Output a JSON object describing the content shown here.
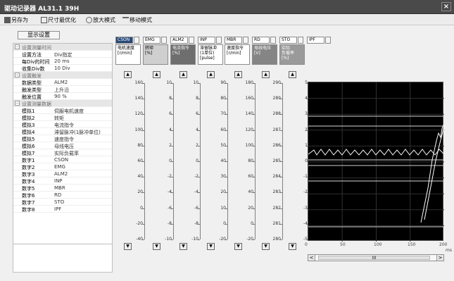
{
  "app_title": "驱动记录器  AL31.1  39H",
  "toolbar": {
    "save_as": "另存为",
    "fit": "尺寸最优化",
    "zoom": "放大模式",
    "move": "移动模式"
  },
  "show_settings": "显示设置",
  "tree": {
    "rows": [
      {
        "type": "group",
        "label": "设置测量时间"
      },
      {
        "type": "item",
        "label": "设置方法",
        "value": "Div指定"
      },
      {
        "type": "item",
        "label": "每Div的时间",
        "value": "20 ms"
      },
      {
        "type": "item",
        "label": "收集Div数",
        "value": "10 Div"
      },
      {
        "type": "group",
        "label": "设置触发"
      },
      {
        "type": "item",
        "label": "数据类型",
        "value": "ALM2"
      },
      {
        "type": "item",
        "label": "触发类型",
        "value": "上升沿"
      },
      {
        "type": "item",
        "label": "触发位置",
        "value": "90 %"
      },
      {
        "type": "group",
        "label": "设置测量数据"
      },
      {
        "type": "item",
        "label": "模拟1",
        "value": "伺服电机速度"
      },
      {
        "type": "item",
        "label": "模拟2",
        "value": "转矩"
      },
      {
        "type": "item",
        "label": "模拟3",
        "value": "电流指令"
      },
      {
        "type": "item",
        "label": "模拟4",
        "value": "滞留脉冲(1脉冲单位)"
      },
      {
        "type": "item",
        "label": "模拟5",
        "value": "速度指令"
      },
      {
        "type": "item",
        "label": "模拟6",
        "value": "母线电压"
      },
      {
        "type": "item",
        "label": "模拟7",
        "value": "实际负载率"
      },
      {
        "type": "item",
        "label": "数字1",
        "value": "CSON"
      },
      {
        "type": "item",
        "label": "数字2",
        "value": "EMG"
      },
      {
        "type": "item",
        "label": "数字3",
        "value": "ALM2"
      },
      {
        "type": "item",
        "label": "数字4",
        "value": "INP"
      },
      {
        "type": "item",
        "label": "数字5",
        "value": "MBR"
      },
      {
        "type": "item",
        "label": "数字6",
        "value": "RD"
      },
      {
        "type": "item",
        "label": "数字7",
        "value": "STO"
      },
      {
        "type": "item",
        "label": "数字8",
        "value": "IPF"
      }
    ]
  },
  "channel_selectors": [
    "CSON",
    "EMG",
    "ALM2",
    "INP",
    "MBR",
    "RD",
    "STO",
    "IPF"
  ],
  "signal_headers": [
    {
      "name": "电机速度",
      "unit": "[r/min]"
    },
    {
      "name": "转矩",
      "unit": "[%]"
    },
    {
      "name": "电流指令",
      "unit": "[%]"
    },
    {
      "name": "滞留脉冲",
      "unit": "(1单位)",
      "unit2": "[pulse]"
    },
    {
      "name": "速度指令",
      "unit": "[r/min]"
    },
    {
      "name": "母线电压",
      "unit": "[V]"
    },
    {
      "name": "实际",
      "unit": "负载率",
      "unit2": "[%]"
    }
  ],
  "axes": [
    {
      "labels": [
        "160",
        "140",
        "120",
        "100",
        "80",
        "60",
        "40",
        "20",
        "0",
        "-20",
        "-40"
      ]
    },
    {
      "labels": [
        "10",
        "8",
        "6",
        "4",
        "2",
        "0",
        "-2",
        "-4",
        "-6",
        "-8",
        "-10"
      ]
    },
    {
      "labels": [
        "10",
        "8",
        "6",
        "4",
        "2",
        "0",
        "-2",
        "-4",
        "-6",
        "-8",
        "-10"
      ]
    },
    {
      "labels": [
        "90",
        "80",
        "70",
        "60",
        "50",
        "40",
        "30",
        "20",
        "10",
        "0",
        "-20"
      ]
    },
    {
      "labels": [
        "180",
        "160",
        "140",
        "120",
        "100",
        "80",
        "60",
        "40",
        "20",
        "0",
        "-20"
      ]
    },
    {
      "labels": [
        "290",
        "289",
        "288",
        "287",
        "286",
        "285",
        "284",
        "283",
        "282",
        "281",
        "280"
      ]
    },
    {
      "labels": [
        "5",
        "4",
        "3",
        "2",
        "1",
        "0",
        "-1",
        "-2",
        "-3",
        "-4",
        "-5"
      ]
    }
  ],
  "plot": {
    "x_ticks": [
      "0",
      "50",
      "100",
      "150",
      "200"
    ],
    "x_unit": "ms"
  },
  "scroll": {
    "thumb": "III"
  }
}
